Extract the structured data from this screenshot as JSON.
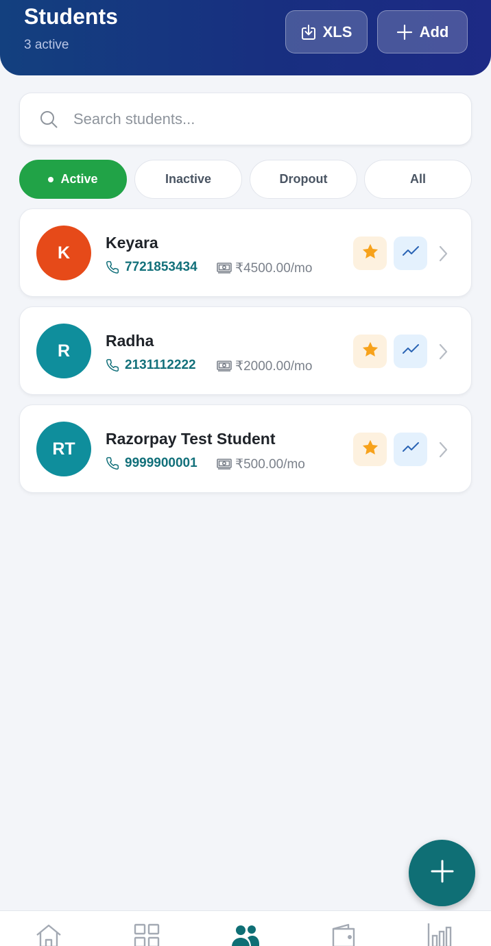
{
  "header": {
    "title": "Students",
    "subtitle": "3 active",
    "export_label": "XLS",
    "add_label": "Add"
  },
  "search": {
    "placeholder": "Search students..."
  },
  "filters": [
    {
      "label": "Active",
      "selected": true
    },
    {
      "label": "Inactive",
      "selected": false
    },
    {
      "label": "Dropout",
      "selected": false
    },
    {
      "label": "All",
      "selected": false
    }
  ],
  "students": [
    {
      "initials": "K",
      "name": "Keyara",
      "phone": "7721853434",
      "fee": "₹4500.00/mo",
      "avatar_color": "#e64a19"
    },
    {
      "initials": "R",
      "name": "Radha",
      "phone": "2131112222",
      "fee": "₹2000.00/mo",
      "avatar_color": "#0f8e9c"
    },
    {
      "initials": "RT",
      "name": "Razorpay Test Student",
      "phone": "9999900001",
      "fee": "₹500.00/mo",
      "avatar_color": "#0f8e9c"
    }
  ],
  "icons": {
    "export": "download-icon",
    "add": "plus-icon",
    "search": "search-icon",
    "phone": "phone-icon",
    "fee": "cash-icon",
    "favorite": "star-icon",
    "progress": "trend-icon",
    "open": "chevron-right-icon",
    "fab": "plus-icon"
  },
  "bottom_nav": [
    {
      "icon": "home-icon",
      "active": false
    },
    {
      "icon": "grid-icon",
      "active": false
    },
    {
      "icon": "users-icon",
      "active": true
    },
    {
      "icon": "wallet-icon",
      "active": false
    },
    {
      "icon": "bar-chart-icon",
      "active": false
    }
  ],
  "colors": {
    "header": "#182f80",
    "active_chip": "#21a347",
    "accent_teal": "#0f6f75",
    "star": "#f7a21b",
    "trend": "#2a64b4"
  }
}
